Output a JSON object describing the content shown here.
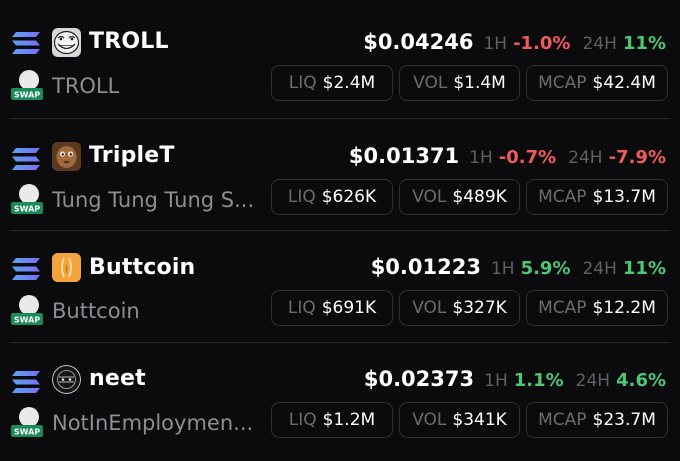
{
  "stat_labels": {
    "liq": "LIQ",
    "vol": "VOL",
    "mcap": "MCAP"
  },
  "timeframes": {
    "h1": "1H",
    "h24": "24H"
  },
  "tokens": [
    {
      "symbol": "TROLL",
      "name": "TROLL",
      "logo": "troll-face-icon",
      "price": "$0.04246",
      "change_1h": "-1.0%",
      "change_24h": "11%",
      "liq": "$2.4M",
      "vol": "$1.4M",
      "mcap": "$42.4M"
    },
    {
      "symbol": "TripleT",
      "name": "Tung Tung Tung S...",
      "logo": "wooden-figure-icon",
      "price": "$0.01371",
      "change_1h": "-0.7%",
      "change_24h": "-7.9%",
      "liq": "$626K",
      "vol": "$489K",
      "mcap": "$13.7M"
    },
    {
      "symbol": "Buttcoin",
      "name": "Buttcoin",
      "logo": "buttcoin-icon",
      "price": "$0.01223",
      "change_1h": "5.9%",
      "change_24h": "11%",
      "liq": "$691K",
      "vol": "$327K",
      "mcap": "$12.2M"
    },
    {
      "symbol": "neet",
      "name": "NotInEmploymen...",
      "logo": "neet-icon",
      "price": "$0.02373",
      "change_1h": "1.1%",
      "change_24h": "4.6%",
      "liq": "$1.2M",
      "vol": "$341K",
      "mcap": "$23.7M"
    }
  ],
  "colors": {
    "background": "#0b0b0d",
    "negative": "#ef5b5b",
    "positive": "#4cc774",
    "muted": "#8d8d93",
    "chip_border": "#2f2f34"
  },
  "chain_icon": "solana-icon",
  "swap_icon": "swap-icon",
  "swap_badge_text": "SWAP"
}
